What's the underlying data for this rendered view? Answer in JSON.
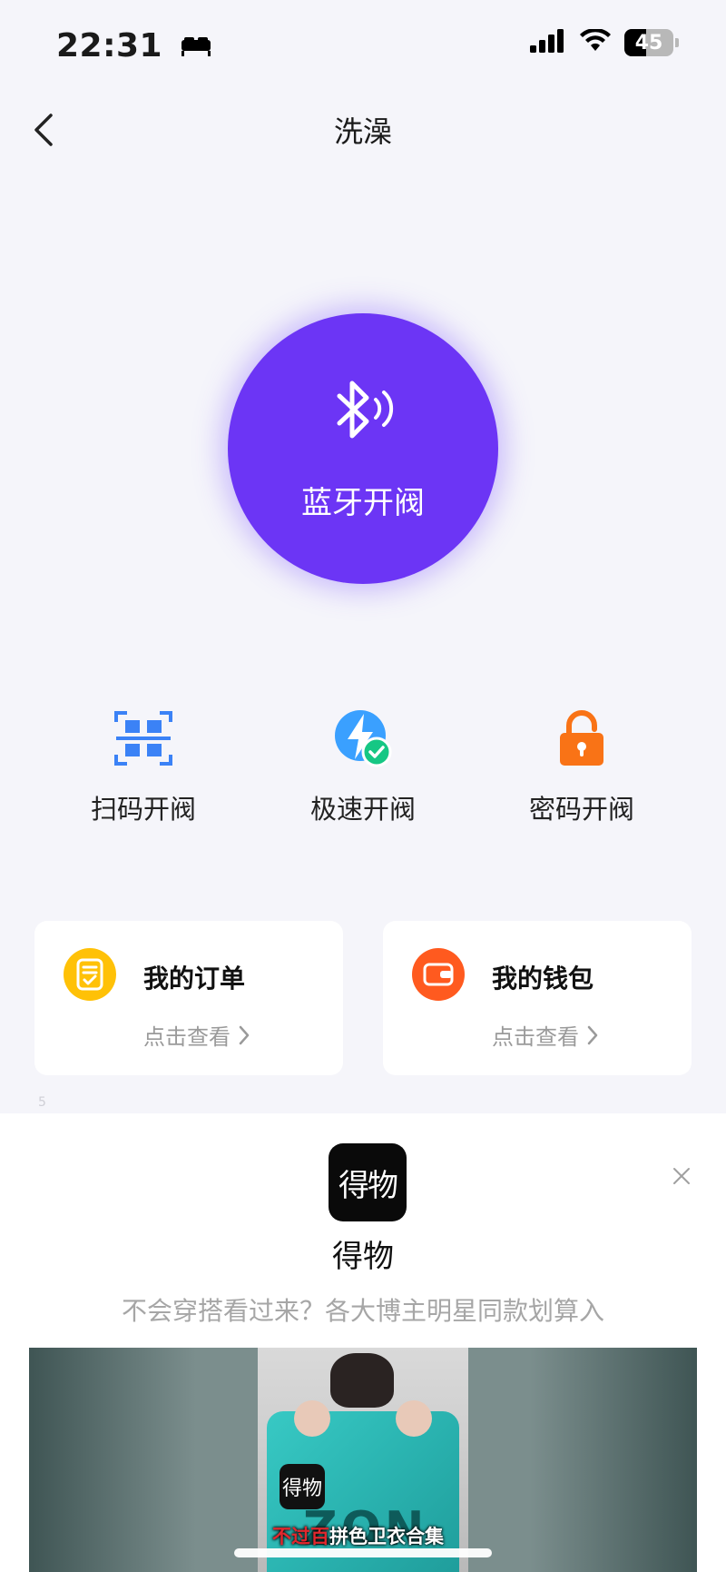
{
  "status_bar": {
    "time": "22:31",
    "battery": "45"
  },
  "nav": {
    "title": "洗澡"
  },
  "main_button": {
    "label": "蓝牙开阀"
  },
  "methods": [
    {
      "label": "扫码开阀",
      "icon": "qr-scan-icon"
    },
    {
      "label": "极速开阀",
      "icon": "lightning-check-icon"
    },
    {
      "label": "密码开阀",
      "icon": "lock-icon"
    }
  ],
  "cards": [
    {
      "title": "我的订单",
      "sub": "点击查看",
      "icon": "order-icon",
      "color": "#ffc107"
    },
    {
      "title": "我的钱包",
      "sub": "点击查看",
      "icon": "wallet-icon",
      "color": "#ff5a1f"
    }
  ],
  "small_number": "5",
  "ad": {
    "logo_text": "得物",
    "name": "得物",
    "description": "不会穿搭看过来？各大博主明星同款划算入",
    "video": {
      "logo_text": "得物",
      "bag_text": "ZON",
      "caption_red": "不过百",
      "caption_white": "拼色卫衣合集"
    }
  },
  "colors": {
    "accent": "#6c35f5",
    "background": "#f5f5fa"
  }
}
